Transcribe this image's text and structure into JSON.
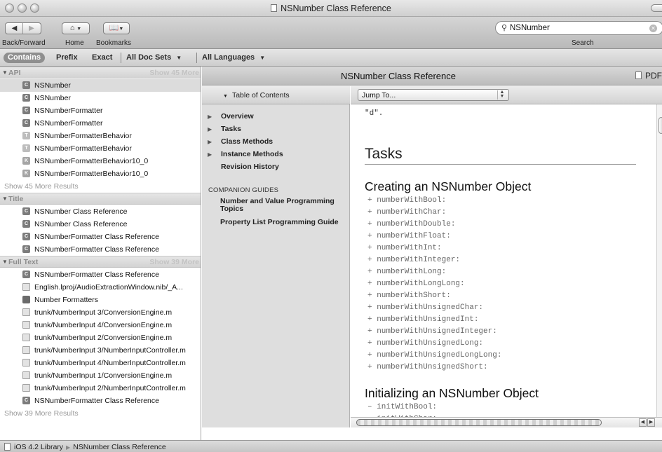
{
  "window": {
    "title": "NSNumber Class Reference"
  },
  "toolbar": {
    "nav_label": "Back/Forward",
    "home_label": "Home",
    "bookmarks_label": "Bookmarks",
    "search_label": "Search",
    "search_value": "NSNumber"
  },
  "scope": {
    "contains": "Contains",
    "prefix": "Prefix",
    "exact": "Exact",
    "docsets": "All Doc Sets",
    "languages": "All Languages"
  },
  "results": {
    "api": {
      "title": "API",
      "more_header": "Show 45 More",
      "items": [
        {
          "kind": "C",
          "label": "NSNumber"
        },
        {
          "kind": "C",
          "label": "NSNumber"
        },
        {
          "kind": "C",
          "label": "NSNumberFormatter"
        },
        {
          "kind": "C",
          "label": "NSNumberFormatter"
        },
        {
          "kind": "T",
          "label": "NSNumberFormatterBehavior"
        },
        {
          "kind": "T",
          "label": "NSNumberFormatterBehavior"
        },
        {
          "kind": "K",
          "label": "NSNumberFormatterBehavior10_0"
        },
        {
          "kind": "K",
          "label": "NSNumberFormatterBehavior10_0"
        }
      ],
      "more_results": "Show 45 More Results"
    },
    "title": {
      "title": "Title",
      "items": [
        {
          "kind": "C",
          "label": "NSNumber Class Reference"
        },
        {
          "kind": "C",
          "label": "NSNumber Class Reference"
        },
        {
          "kind": "C",
          "label": "NSNumberFormatter Class Reference"
        },
        {
          "kind": "C",
          "label": "NSNumberFormatter Class Reference"
        }
      ]
    },
    "fulltext": {
      "title": "Full Text",
      "more_header": "Show 39 More",
      "items": [
        {
          "kind": "C",
          "label": "NSNumberFormatter Class Reference"
        },
        {
          "kind": "doc",
          "label": "English.lproj/AudioExtractionWindow.nib/_A..."
        },
        {
          "kind": "book",
          "label": "Number Formatters"
        },
        {
          "kind": "doc",
          "label": "trunk/NumberInput 3/ConversionEngine.m"
        },
        {
          "kind": "doc",
          "label": "trunk/NumberInput 4/ConversionEngine.m"
        },
        {
          "kind": "doc",
          "label": "trunk/NumberInput 2/ConversionEngine.m"
        },
        {
          "kind": "doc",
          "label": "trunk/NumberInput 3/NumberInputController.m"
        },
        {
          "kind": "doc",
          "label": "trunk/NumberInput 4/NumberInputController.m"
        },
        {
          "kind": "doc",
          "label": "trunk/NumberInput 1/ConversionEngine.m"
        },
        {
          "kind": "doc",
          "label": "trunk/NumberInput 2/NumberInputController.m"
        },
        {
          "kind": "C",
          "label": "NSNumberFormatter Class Reference"
        }
      ],
      "more_results": "Show 39 More Results"
    }
  },
  "doc": {
    "header_title": "NSNumber Class Reference",
    "pdf_label": "PDF",
    "toc_title": "Table of Contents",
    "toc_items": [
      {
        "label": "Overview",
        "arrow": true
      },
      {
        "label": "Tasks",
        "arrow": true
      },
      {
        "label": "Class Methods",
        "arrow": true
      },
      {
        "label": "Instance Methods",
        "arrow": true
      },
      {
        "label": "Revision History",
        "arrow": false
      }
    ],
    "companion_title": "COMPANION GUIDES",
    "companion_items": [
      "Number and Value Programming Topics",
      "Property List Programming Guide"
    ],
    "jump_value": "Jump To...",
    "fragment_text": "\"d\".",
    "tasks_heading": "Tasks",
    "creating_heading": "Creating an NSNumber Object",
    "creating_methods": [
      "+ numberWithBool:",
      "+ numberWithChar:",
      "+ numberWithDouble:",
      "+ numberWithFloat:",
      "+ numberWithInt:",
      "+ numberWithInteger:",
      "+ numberWithLong:",
      "+ numberWithLongLong:",
      "+ numberWithShort:",
      "+ numberWithUnsignedChar:",
      "+ numberWithUnsignedInt:",
      "+ numberWithUnsignedInteger:",
      "+ numberWithUnsignedLong:",
      "+ numberWithUnsignedLongLong:",
      "+ numberWithUnsignedShort:"
    ],
    "initializing_heading": "Initializing an NSNumber Object",
    "init_methods": [
      "– initWithBool:",
      "– initWithChar:"
    ]
  },
  "status": {
    "library": "iOS 4.2 Library",
    "page": "NSNumber Class Reference"
  }
}
